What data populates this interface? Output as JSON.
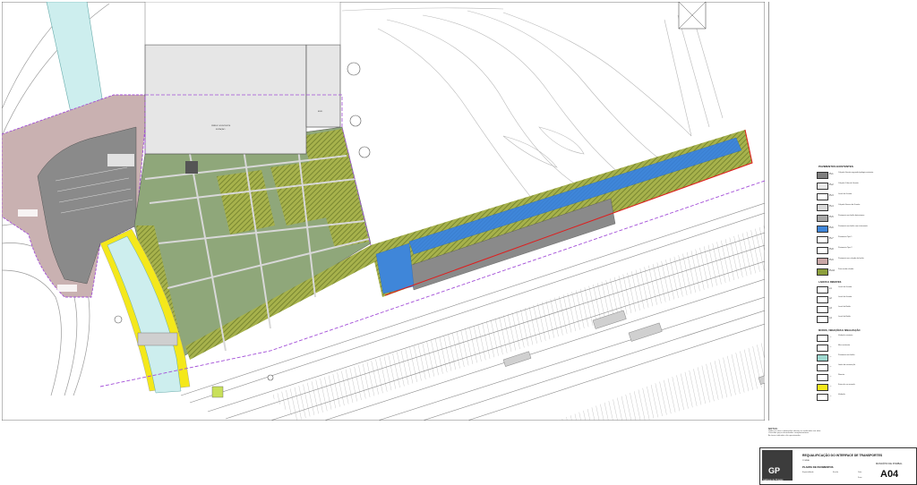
{
  "drawing": {
    "building_label_main": "PRÉDIO EXISTENTE",
    "building_label_main_sub": "ESTAÇÃO",
    "building_label_side": "EDIF."
  },
  "legend": {
    "title": "PAVIMENTOS EXISTENTES",
    "items": [
      {
        "code": "Pv.1",
        "color": "#7f7f7f",
        "desc": "Calçada Granito segundo tipologia existente"
      },
      {
        "code": "Pv.2",
        "color": "#e9e9e9",
        "desc": "Calçada Cubo de Granito"
      },
      {
        "code": "Pv.3",
        "color": "#ffffff",
        "desc": "Lancil de Granito"
      },
      {
        "code": "Pv.4",
        "color": "#d9d9d9",
        "desc": "Calçada Grossa de Granito"
      },
      {
        "code": "Pv.5",
        "color": "#a8a8a8",
        "desc": "Pavimento em betão betuminoso"
      },
      {
        "code": "Pv.6",
        "color": "#3f86d9",
        "desc": "Pavimento em betão com tratamento"
      },
      {
        "code": "Pv.7",
        "color": "#ffffff",
        "desc": "Pavimento Tipo 1"
      },
      {
        "code": "Pv.8",
        "color": "#ffffff",
        "desc": "Pavimento Tipo 2"
      },
      {
        "code": "Pv.9",
        "color": "#c9a7a7",
        "desc": "Pavimento em calçada de betão"
      },
      {
        "code": "Pv.10",
        "color": "#8c9f3c",
        "desc": "Zona verde relvada"
      }
    ],
    "section_lancis": "LANCIS E REMATES",
    "lancis": [
      {
        "code": "L1",
        "desc": "Lancil de Granito"
      },
      {
        "code": "L2",
        "desc": "Lancil de Granito"
      },
      {
        "code": "L3",
        "desc": "Lancil de Betão"
      },
      {
        "code": "L4",
        "desc": "Lancil de Betão"
      }
    ],
    "section_limits": "MUROS, VEDAÇÕES E SINALIZAÇÃO",
    "limits": [
      {
        "code": "—",
        "color": "#ffffff",
        "desc": "Vedação existente"
      },
      {
        "code": "—",
        "color": "#ffffff",
        "desc": "Muro existente"
      },
      {
        "code": "—",
        "color": "#9fd9d0",
        "desc": "Pavimento em betão"
      },
      {
        "code": "—",
        "color": "#ffffff",
        "desc": "Limite de intervenção"
      },
      {
        "code": "—",
        "color": "#ffffff",
        "desc": "Remate"
      },
      {
        "code": "—",
        "color": "#f4e81b",
        "desc": "Faixa de cor amarela"
      },
      {
        "code": "—",
        "color": "#ffffff",
        "desc": "Vedação"
      }
    ]
  },
  "notes": {
    "heading": "NOTAS:",
    "lines": [
      "Todas as cotas e dimensões devem ser verificadas em obra.",
      "Consultar peças desenhadas complementares.",
      "As áreas indicadas são aproximadas."
    ]
  },
  "titleblock": {
    "logo_text": "GP",
    "logo_sub": "Gabinete de Projetos",
    "project": "REQUALIFICAÇÃO DO INTERFACE DE TRANSPORTES",
    "client": "MUNICÍPIO DE POMBAL",
    "drawing_title": "PLANTA DE PAVIMENTOS",
    "number": "A04",
    "cell_labels": [
      "POMBAL",
      "Especialidade",
      "Escala",
      "Data",
      "Fase"
    ]
  },
  "colors": {
    "grass": "#8fa77a",
    "hatch": "#8c9f3c",
    "plaza": "#8a8a8a",
    "pink_pavement": "#c9b1b1",
    "water_cyan": "#cdeeee",
    "yellow": "#f4e81b",
    "blue": "#3f86d9",
    "building": "#e6e6e6",
    "boundary_purple": "#a34fd8",
    "boundary_red": "#e01c1c"
  }
}
